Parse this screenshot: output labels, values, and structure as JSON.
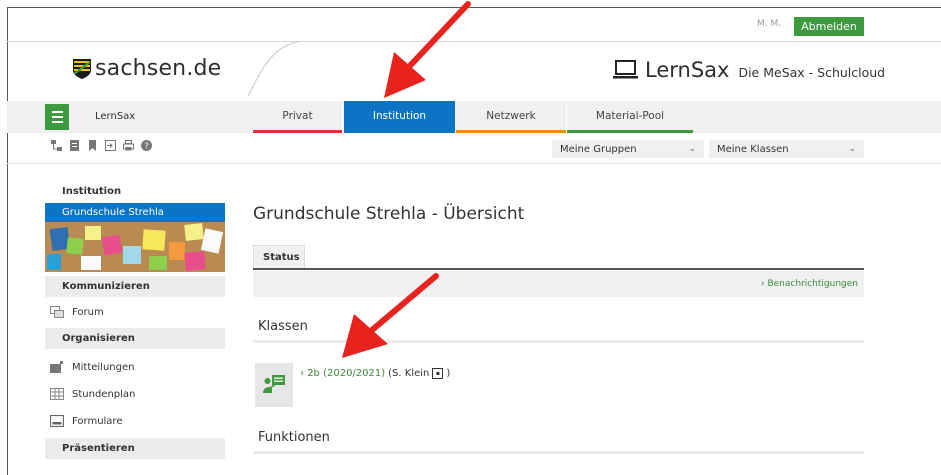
{
  "header": {
    "user_initials": "M. M.",
    "logout_label": "Abmelden",
    "logo_text": "sachsen.de",
    "brand_title": "LernSax",
    "brand_subtitle": "Die MeSax - Schulcloud"
  },
  "nav": {
    "brand": "LernSax",
    "tabs": [
      {
        "label": "Privat",
        "color": "#d9343c"
      },
      {
        "label": "Institution",
        "color": "#0b74c4",
        "active": true
      },
      {
        "label": "Netzwerk",
        "color": "#f08a24"
      },
      {
        "label": "Material-Pool",
        "color": "#3d9a3e"
      }
    ]
  },
  "toolbar": {
    "icons": [
      "sitemap-icon",
      "notepad-icon",
      "bookmark-icon",
      "login-icon",
      "print-icon",
      "help-icon"
    ],
    "groups_select": "Meine Gruppen",
    "classes_select": "Meine Klassen"
  },
  "sidebar": {
    "heading": "Institution",
    "active_item": "Grundschule Strehla",
    "sections": [
      {
        "title": "Kommunizieren",
        "items": [
          {
            "label": "Forum",
            "icon": "forum-icon"
          }
        ]
      },
      {
        "title": "Organisieren",
        "items": [
          {
            "label": "Mitteilungen",
            "icon": "announcement-icon"
          },
          {
            "label": "Stundenplan",
            "icon": "timetable-icon"
          },
          {
            "label": "Formulare",
            "icon": "form-icon"
          }
        ]
      },
      {
        "title": "Präsentieren",
        "items": []
      }
    ]
  },
  "main": {
    "title": "Grundschule Strehla - Übersicht",
    "status_tab": "Status",
    "notifications_link": "Benachrichtigungen",
    "classes_heading": "Klassen",
    "class_link": "2b (2020/2021)",
    "class_teacher": "(S. Klein",
    "class_teacher_end": ")",
    "functions_heading": "Funktionen"
  },
  "colors": {
    "accent_green": "#3d9a3e",
    "active_blue": "#0b74c4",
    "annotation_red": "#e8221d"
  }
}
